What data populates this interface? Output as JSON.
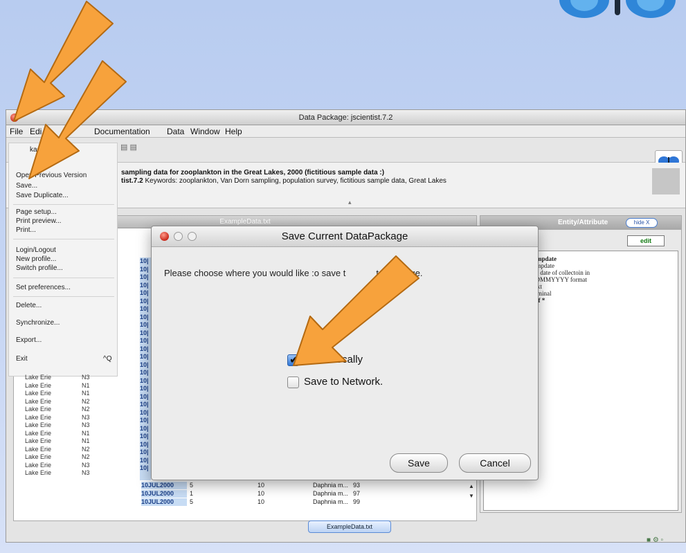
{
  "window": {
    "title": "Data Package: jscientist.7.2"
  },
  "menubar": {
    "file": "File",
    "edit": "Edi",
    "documentation": "Documentation",
    "data": "Data",
    "window": "Window",
    "help": "Help"
  },
  "info": {
    "line1": "sampling data for zooplankton in the Great Lakes,      2000 (fictitious sample data :)",
    "line2_id": "tist.7.2",
    "line2_rest": " Keywords:  zooplankton, Van Dorn sampling, population survey, fictitious sample data, Great Lakes"
  },
  "table": {
    "header_title": "ExampleData.txt",
    "rows": [
      {
        "lake": "Lake Erie",
        "site": "N3",
        "date": "10JUL2000",
        "n": "5",
        "depth": "10",
        "taxon": "Daphnia m...",
        "count": "93"
      },
      {
        "lake": "Lake Erie",
        "site": "N3",
        "date": "10JUL2000",
        "n": "1",
        "depth": "10",
        "taxon": "Daphnia m...",
        "count": "97"
      },
      {
        "lake": "Lake Erie",
        "site": "N3",
        "date": "10JUL2000",
        "n": "5",
        "depth": "10",
        "taxon": "Daphnia m...",
        "count": "99"
      }
    ],
    "date_stub": "10|"
  },
  "lake_rows": [
    {
      "lake": "Lake Erie",
      "site": "N3"
    },
    {
      "lake": "Lake Erie",
      "site": "N1"
    },
    {
      "lake": "Lake Erie",
      "site": "N1"
    },
    {
      "lake": "Lake Erie",
      "site": "N2"
    },
    {
      "lake": "Lake Erie",
      "site": "N2"
    },
    {
      "lake": "Lake Erie",
      "site": "N3"
    },
    {
      "lake": "Lake Erie",
      "site": "N3"
    },
    {
      "lake": "Lake Erie",
      "site": "N1"
    },
    {
      "lake": "Lake Erie",
      "site": "N1"
    },
    {
      "lake": "Lake Erie",
      "site": "N2"
    },
    {
      "lake": "Lake Erie",
      "site": "N2"
    },
    {
      "lake": "Lake Erie",
      "site": "N3"
    },
    {
      "lake": "Lake Erie",
      "site": "N3"
    }
  ],
  "right_panel": {
    "title": "Entity/Attribute",
    "hide_label": "hide X",
    "edit_label": "edit",
    "attributes": [
      {
        "key": "",
        "value": "sampdate"
      },
      {
        "key": "",
        "value": "sampdate"
      },
      {
        "key": "",
        "value": "the date of collectoin in"
      },
      {
        "key": "",
        "value": "DDMMYYYY format"
      },
      {
        "key": "",
        "value": "Text"
      },
      {
        "key": "rpe",
        "value": "nominal"
      },
      {
        "key": "omain",
        "value": "Def    *"
      },
      {
        "key": "Code",
        "value": ""
      },
      {
        "key": "t",
        "value": ""
      },
      {
        "key": "ment",
        "value": ""
      }
    ]
  },
  "file_menu": {
    "items": [
      {
        "label": "kage..."
      },
      {
        "label": ""
      },
      {
        "label": "Open Previous Version"
      },
      {
        "label": "Save..."
      },
      {
        "label": "Save Duplicate..."
      },
      {
        "label": "Page setup..."
      },
      {
        "label": "Print preview..."
      },
      {
        "label": "Print..."
      },
      {
        "label": "Login/Logout"
      },
      {
        "label": "New profile..."
      },
      {
        "label": "Switch profile..."
      },
      {
        "label": "Set preferences..."
      },
      {
        "label": "Delete..."
      },
      {
        "label": "Synchronize..."
      },
      {
        "label": "Export..."
      },
      {
        "label": "Exit"
      }
    ],
    "exit_shortcut": "^Q"
  },
  "dialog": {
    "title": "Save Current DataPackage",
    "message": "Please choose where you would like :o save t",
    "message_tail": "ta package.",
    "options": [
      {
        "label": "Save Locally",
        "checked": true
      },
      {
        "label": "Save to Network.",
        "checked": false
      }
    ],
    "save_label": "Save",
    "cancel_label": "Cancel"
  },
  "status": {
    "tab_label": "ExampleData.txt"
  },
  "colors": {
    "arrow": "#f7a23c",
    "accent": "#2f76d6",
    "background": "#c0d2f2"
  }
}
